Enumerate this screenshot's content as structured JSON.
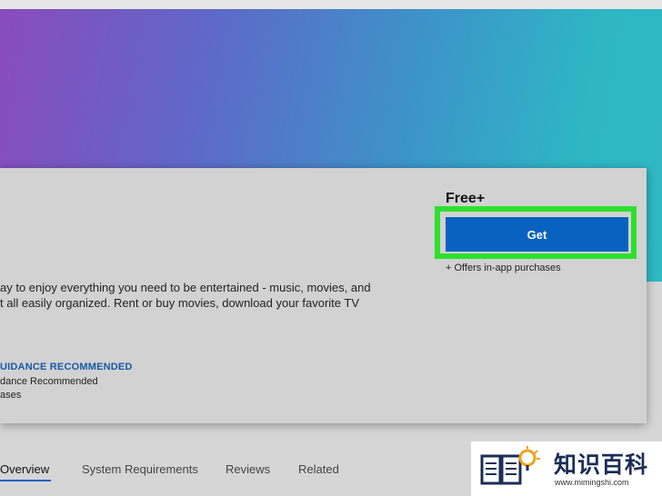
{
  "pricing": {
    "price": "Free+",
    "get_label": "Get",
    "iap_note": "+ Offers in-app purchases"
  },
  "description": {
    "lines": [
      "ay to enjoy everything you need to be entertained - music, movies, and",
      "t all easily organized. Rent or buy movies, download your favorite TV"
    ]
  },
  "rating": {
    "title": "UIDANCE RECOMMENDED",
    "line1": "dance Recommended",
    "line2": "ases"
  },
  "tabs": [
    {
      "label": "Overview"
    },
    {
      "label": "System Requirements"
    },
    {
      "label": "Reviews"
    },
    {
      "label": "Related"
    }
  ],
  "watermark": {
    "name": "知识百科",
    "url": "www.mimingshi.com"
  },
  "colors": {
    "accent": "#0a62c0",
    "highlight": "#2ee02e",
    "rating_link": "#1559a8"
  }
}
